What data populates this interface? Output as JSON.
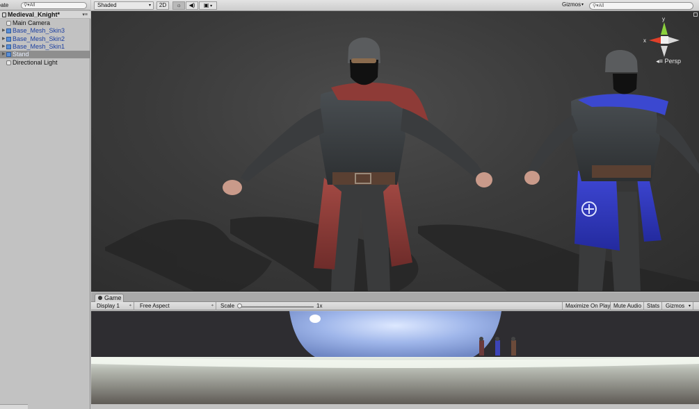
{
  "hierarchy": {
    "create_label": "reate",
    "search_placeholder": "All",
    "scene_name": "Medieval_Knight*",
    "scene_menu": "▾≡",
    "items": [
      {
        "label": "Main Camera",
        "style": "plain",
        "expand": false
      },
      {
        "label": "Base_Mesh_Skin3",
        "style": "blue",
        "expand": true
      },
      {
        "label": "Base_Mesh_Skin2",
        "style": "blue",
        "expand": true
      },
      {
        "label": "Base_Mesh_Skin1",
        "style": "blue",
        "expand": true
      },
      {
        "label": "Stand",
        "style": "selected",
        "expand": true
      },
      {
        "label": "Directional Light",
        "style": "plain",
        "expand": false
      }
    ]
  },
  "scene_toolbar": {
    "shading_mode": "Shaded",
    "mode_2d": "2D",
    "light_icon": "sun-icon",
    "audio_icon": "speaker-icon",
    "effects_icon": "image-icon",
    "gizmos_label": "Gizmos",
    "search_placeholder": "All"
  },
  "scene_view": {
    "projection_label": "Persp",
    "gizmo_axes": {
      "x": "x",
      "y": "y"
    },
    "colors": {
      "x_axis": "#e0402a",
      "y_axis": "#8bd13d",
      "z_axis": "#3f6fe0",
      "background": "#3b3b3b"
    }
  },
  "game_panel": {
    "tab_label": "Game",
    "display": "Display 1",
    "aspect": "Free Aspect",
    "scale_label": "Scale",
    "scale_value": "1x",
    "scale_slider_fraction": 0.0,
    "maximize_label": "Maximize On Play",
    "mute_label": "Mute Audio",
    "stats_label": "Stats",
    "gizmos_label": "Gizmos"
  }
}
